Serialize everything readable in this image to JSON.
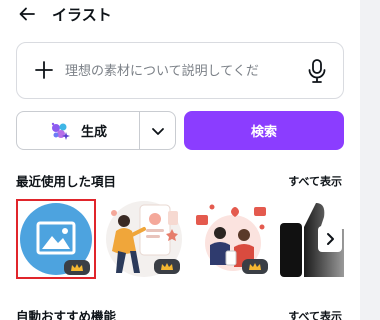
{
  "header": {
    "title": "イラスト",
    "back_icon": "arrow-left-icon"
  },
  "search": {
    "placeholder": "理想の素材について説明してくだ",
    "value": ""
  },
  "generate": {
    "label": "生成",
    "icon": "sparkle-magic-icon"
  },
  "search_button": {
    "label": "検索"
  },
  "recent": {
    "title": "最近使用した項目",
    "see_all": "すべて表示",
    "items": [
      {
        "name": "image-placeholder",
        "premium": true
      },
      {
        "name": "woman-with-phone-illustration",
        "premium": true
      },
      {
        "name": "couple-social-media-illustration",
        "premium": true
      },
      {
        "name": "thumbs-up-illustration",
        "premium": false
      }
    ]
  },
  "recommended": {
    "title": "自動おすすめ機能",
    "see_all": "すべて表示"
  },
  "colors": {
    "accent": "#8b3dff",
    "selection": "#e0252b",
    "image_blue": "#4da3df"
  }
}
